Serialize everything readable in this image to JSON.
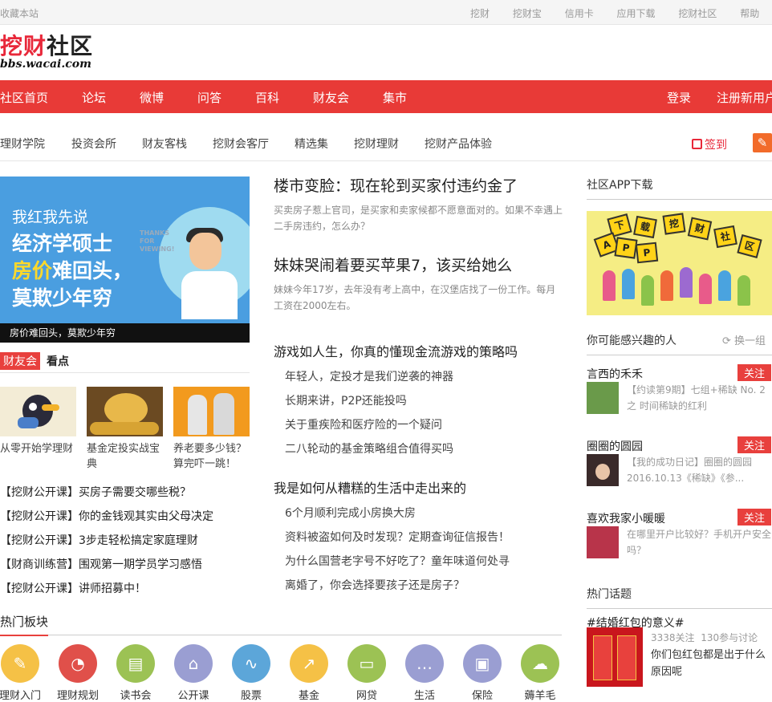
{
  "topbar": {
    "favorite": "收藏本站",
    "links": [
      "挖财",
      "挖财宝",
      "信用卡",
      "应用下载",
      "挖财社区",
      "帮助"
    ]
  },
  "logo": {
    "text_red": "挖财",
    "text_dark": "社区",
    "url": "bbs.wacai.com"
  },
  "nav": {
    "items": [
      "社区首页",
      "论坛",
      "微博",
      "问答",
      "百科",
      "财友会",
      "集市"
    ],
    "login": "登录",
    "register": "注册新用户"
  },
  "subnav": {
    "items": [
      "理财学院",
      "投资会所",
      "财友客栈",
      "挖财会客厅",
      "精选集",
      "挖财理财",
      "挖财产品体验"
    ],
    "signin": "签到"
  },
  "banner": {
    "line1": "我红我先说",
    "line2a": "经济学硕士",
    "line2b_highlight": "房价",
    "line2b_rest": "难回头，",
    "line3": "莫欺少年穷",
    "bubble": "THANKS FOR VIEWING!",
    "caption": "房价难回头，莫欺少年穷"
  },
  "kandian": {
    "tag": "财友会",
    "title": "看点",
    "items": [
      {
        "caption": "从零开始学理财"
      },
      {
        "caption": "基金定投实战宝典"
      },
      {
        "caption": "养老要多少钱？算完吓一跳！"
      }
    ]
  },
  "left_links": [
    "【挖财公开课】买房子需要交哪些税？",
    "【挖财公开课】你的金钱观其实由父母决定",
    "【挖财公开课】3步走轻松搞定家庭理财",
    "【财商训练营】围观第一期学员学习感悟",
    "【挖财公开课】讲师招募中！"
  ],
  "hot_sections": {
    "title": "热门板块",
    "items": [
      {
        "label": "理财入门",
        "icon": "notepad-icon",
        "color": "#f5c146"
      },
      {
        "label": "理财规划",
        "icon": "pie-chart-icon",
        "color": "#e0504a"
      },
      {
        "label": "读书会",
        "icon": "book-icon",
        "color": "#9cc254"
      },
      {
        "label": "公开课",
        "icon": "presentation-icon",
        "color": "#9a9ed2"
      },
      {
        "label": "股票",
        "icon": "line-chart-icon",
        "color": "#5ca6d9"
      },
      {
        "label": "基金",
        "icon": "growth-chart-icon",
        "color": "#f5c146"
      },
      {
        "label": "网贷",
        "icon": "monitor-icon",
        "color": "#9cc254"
      },
      {
        "label": "生活",
        "icon": "chat-icon",
        "color": "#9a9ed2"
      },
      {
        "label": "保险",
        "icon": "safe-icon",
        "color": "#9a9ed2"
      },
      {
        "label": "薅羊毛",
        "icon": "sheep-icon",
        "color": "#9cc254"
      }
    ]
  },
  "articles": [
    {
      "title": "楼市变脸：现在轮到买家付违约金了",
      "desc": "买卖房子惹上官司，是买家和卖家候都不愿意面对的。如果不幸遇上二手房违约，怎么办？"
    },
    {
      "title": "妹妹哭闹着要买苹果7，该买给她么",
      "desc": "妹妹今年17岁，去年没有考上高中，在汉堡店找了一份工作。每月工资在2000左右。"
    }
  ],
  "groups": [
    {
      "title": "游戏如人生，你真的懂现金流游戏的策略吗",
      "items": [
        "年轻人，定投才是我们逆袭的神器",
        "长期来讲，P2P还能投吗",
        "关于重疾险和医疗险的一个疑问",
        "二八轮动的基金策略组合值得买吗"
      ]
    },
    {
      "title": "我是如何从糟糕的生活中走出来的",
      "items": [
        "6个月顺利完成小房换大房",
        "资料被盗如何及时发现？定期查询征信报告！",
        "为什么国营老字号不好吃了？童年味道何处寻",
        "离婚了，你会选择要孩子还是房子？"
      ]
    }
  ],
  "right": {
    "app_title": "社区APP下载",
    "app_signs": [
      "下",
      "载",
      "挖",
      "财",
      "社",
      "区",
      "A",
      "P",
      "P"
    ],
    "people_title": "你可能感兴趣的人",
    "refresh": "换一组",
    "follow": "关注",
    "people": [
      {
        "name": "言西的禾禾",
        "text": "【约读第9期】七组+稀缺 No. 2 之 时间稀缺的红利"
      },
      {
        "name": "圈圈的圆园",
        "text": "【我的成功日记】圈圈的圆园 2016.10.13《稀缺》《参..."
      },
      {
        "name": "喜欢我家小暖暖",
        "text": "在哪里开户比较好？手机开户安全吗？"
      }
    ],
    "topics_title": "热门话题",
    "topic": {
      "title": "#结婚红包的意义#",
      "followers": "3338关注",
      "participants": "130参与讨论",
      "question": "你们包红包都是出于什么原因呢"
    }
  }
}
